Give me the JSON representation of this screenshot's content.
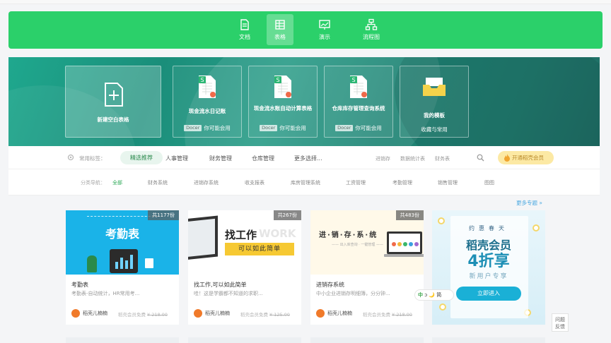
{
  "doc_types": [
    {
      "label": "文档",
      "icon": "document-icon"
    },
    {
      "label": "表格",
      "icon": "table-icon"
    },
    {
      "label": "演示",
      "icon": "presentation-icon"
    },
    {
      "label": "流程图",
      "icon": "flowchart-icon"
    }
  ],
  "hero": {
    "blank_label": "新建空白表格",
    "templates": [
      {
        "title": "现金流水日记账",
        "badge": "Docer",
        "note": "你可能会用"
      },
      {
        "title": "现金流水账自动计算表格",
        "badge": "Docer",
        "note": "你可能会用"
      },
      {
        "title": "仓库库存管理查询系统",
        "badge": "Docer",
        "note": "你可能会用"
      },
      {
        "title": "我的模板",
        "note": "收藏与常用"
      }
    ]
  },
  "filters": {
    "common_label": "常用标签：",
    "selected": "精选推荐",
    "tags": [
      "人事管理",
      "财务管理",
      "仓库管理",
      "更多选择..."
    ],
    "search_hints": [
      "进销存",
      "数据统计表",
      "财务表"
    ],
    "vip_button": "开通稻壳会员",
    "category_label": "分类导航：",
    "categories": [
      "全部",
      "财务系统",
      "进销存系统",
      "收支报表",
      "库房管理系统",
      "工资管理",
      "考勤管理",
      "销售管理",
      "图图"
    ]
  },
  "more_link": "更多专题 »",
  "cards": [
    {
      "count": "共1177份",
      "thumb_text": "考勤表",
      "name": "考勤表",
      "desc": "考勤表-自动统计，HR常用考...",
      "author": "稻壳儿楠楠",
      "price_label": "稻壳会员免费",
      "orig_price": "¥ 218.00"
    },
    {
      "count": "共267份",
      "thumb_title": "找工作",
      "thumb_ghost": "WORK",
      "thumb_band": "可以如此简单",
      "name": "找工作,可以如此简单",
      "desc": "哇！这是学霸都不知道的求职...",
      "author": "稻壳儿楠楠",
      "price_label": "稻壳会员免费",
      "orig_price": "¥ 125.00"
    },
    {
      "count": "共483份",
      "thumb_title": "进·销·存·系·统",
      "thumb_sub": "—— 出入库查询 · 一键管理 ——",
      "name": "进销存系统",
      "desc": "中小企业进销存明细簿，分分钟...",
      "author": "稻壳儿楠楠",
      "price_label": "稻壳会员免费",
      "orig_price": "¥ 218.00"
    }
  ],
  "promo": {
    "line1": "约惠春天",
    "line2": "稻壳会员",
    "line3": "4折享",
    "line4": "新用户专享",
    "button": "立即进入"
  },
  "ime": {
    "text": "中",
    "rest": "ɔ 🌙 简"
  },
  "help": {
    "line1": "问题",
    "line2": "反馈"
  },
  "colors": {
    "brand_green": "#2bd06a",
    "vip_yellow": "#fce9a4",
    "link_blue": "#4aa8e0"
  }
}
